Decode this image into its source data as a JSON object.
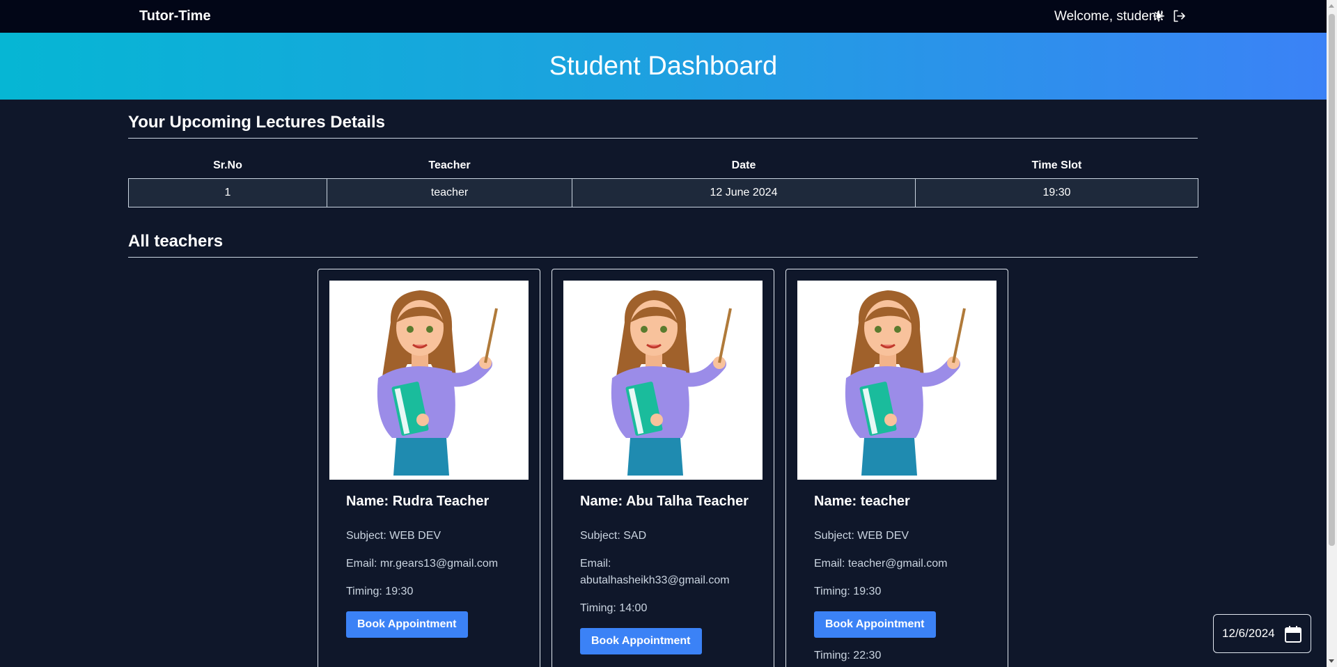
{
  "navbar": {
    "brand": "Tutor-Time",
    "welcome": "Welcome, student!",
    "theme_icon": "sun-icon",
    "logout_icon": "logout-icon"
  },
  "hero": {
    "title": "Student Dashboard"
  },
  "lectures": {
    "title": "Your Upcoming Lectures Details",
    "headers": [
      "Sr.No",
      "Teacher",
      "Date",
      "Time Slot"
    ],
    "rows": [
      {
        "srno": "1",
        "teacher": "teacher",
        "date": "12 June 2024",
        "slot": "19:30"
      }
    ]
  },
  "teachers": {
    "title": "All teachers",
    "cards": [
      {
        "name": "Name: Rudra Teacher",
        "subject": "Subject: WEB DEV",
        "email": "Email: mr.gears13@gmail.com",
        "timings": [
          "Timing: 19:30"
        ],
        "button": "Book Appointment"
      },
      {
        "name": "Name: Abu Talha Teacher",
        "subject": "Subject: SAD",
        "email_label": "Email:",
        "email_value": "abutalhasheikh33@gmail.com",
        "timings": [
          "Timing: 14:00"
        ],
        "button": "Book Appointment"
      },
      {
        "name": "Name: teacher",
        "subject": "Subject: WEB DEV",
        "email": "Email: teacher@gmail.com",
        "timings": [
          "Timing: 19:30",
          "Timing: 22:30"
        ],
        "button": "Book Appointment"
      }
    ]
  },
  "date_widget": {
    "value": "12/6/2024",
    "icon": "calendar-icon"
  },
  "colors": {
    "background": "#0f172a",
    "navbar": "#020617",
    "accent": "#3b82f6",
    "gradient_start": "#06b6d4"
  }
}
